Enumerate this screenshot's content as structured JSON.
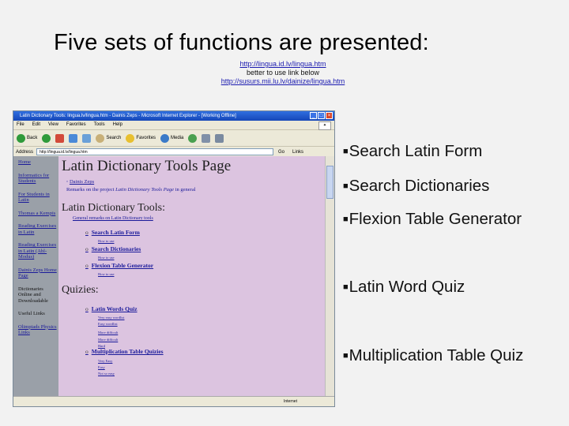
{
  "slide": {
    "title": "Five sets of functions are presented:",
    "link1": "http://lingua.id.lv/lingua.htm",
    "note": "better to use link below",
    "link2": "http://susurs.mii.lu.lv/dainize/lingua.htm"
  },
  "browser": {
    "window_title": "Latin Dictionary Tools: lingua.lv/lingua.htm - Dainis Zeps - Microsoft Internet Explorer - [Working Offline]",
    "menu": [
      "File",
      "Edit",
      "View",
      "Favorites",
      "Tools",
      "Help"
    ],
    "toolbar": {
      "back": "Back",
      "search": "Search",
      "favorites": "Favorites",
      "media": "Media"
    },
    "address_label": "Address",
    "address": "http://lingua.id.lv/lingua.htm",
    "go": "Go",
    "links": "Links",
    "status": "Internet",
    "sidebar": [
      "Home",
      "Informatics for Students",
      "For Students in Latin",
      "Thomas a Kempis",
      "Reading Exercises in Latin",
      "Reading Exercises in Latin (Abl-Modus)",
      "Dainis Zeps Home Page",
      "Dictionaries Online and Downloadable",
      "Useful Links",
      "Olimpiads Physics Links"
    ],
    "page": {
      "title": "Latin Dictionary Tools Page",
      "author": "Dainis Zeps",
      "remarks": "Remarks on the project",
      "remarks_link": "Latin Dictionary Tools Page",
      "remarks_tail": "in general",
      "tools_heading": "Latin Dictionary Tools:",
      "tools_remark": "General remarks on Latin Dictionary tools",
      "tools": [
        {
          "label": "Search Latin Form",
          "sub": "How to use"
        },
        {
          "label": "Search Dictionaries",
          "sub": "How to use"
        },
        {
          "label": "Flexion Table Generator",
          "sub": "How to use"
        }
      ],
      "quiz_heading": "Quizies:",
      "quiz1": "Latin Words Quiz",
      "quiz1_subs": [
        "Very easy wordlist",
        "Easy wordlist",
        "More difficult",
        "More difficult",
        "Hard"
      ],
      "quiz2": "Multiplication Table Quizies",
      "quiz2_subs": [
        "Very Easy",
        "Easy",
        "Not so easy"
      ]
    }
  },
  "bullets": [
    "Search Latin Form",
    "Search Dictionaries",
    "Flexion Table Generator",
    "Latin Word Quiz",
    "Multiplication Table Quiz"
  ],
  "colors": {
    "background": "#f2f2f2",
    "page_bg": "#dcc4e0",
    "sidebar_bg": "#9aa0a8",
    "link": "#1a1a9a"
  }
}
